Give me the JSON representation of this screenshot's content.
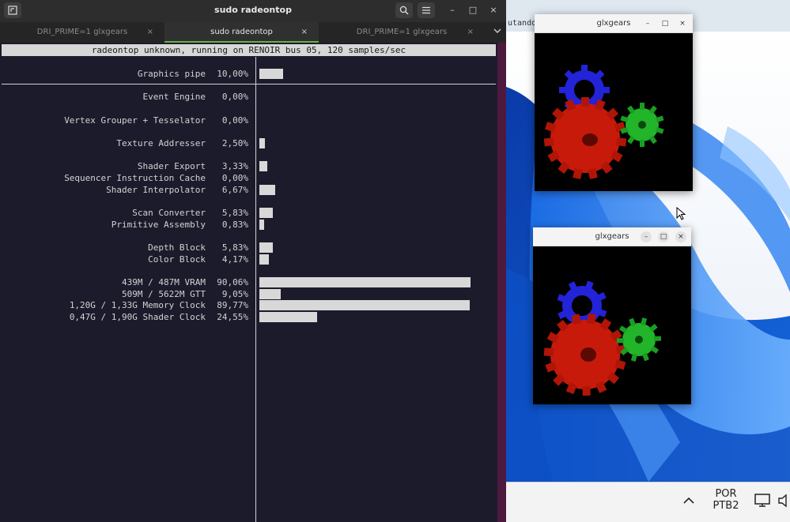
{
  "terminal": {
    "title": "sudo radeontop",
    "tabs": [
      {
        "label": "DRI_PRIME=1 glxgears"
      },
      {
        "label": "sudo radeontop"
      },
      {
        "label": "DRI_PRIME=1 glxgears"
      }
    ],
    "active_tab": 1,
    "header": "radeontop unknown, running on RENOIR bus 05, 120 samples/sec",
    "stats": [
      {
        "label": "Graphics pipe",
        "value": "10,00%",
        "fraction": 0.1
      },
      {
        "label": "Event Engine",
        "value": "0,00%",
        "fraction": 0.0
      },
      {
        "label": "Vertex Grouper + Tesselator",
        "value": "0,00%",
        "fraction": 0.0
      },
      {
        "label": "Texture Addresser",
        "value": "2,50%",
        "fraction": 0.025
      },
      {
        "label": "Shader Export",
        "value": "3,33%",
        "fraction": 0.0333
      },
      {
        "label": "Sequencer Instruction Cache",
        "value": "0,00%",
        "fraction": 0.0
      },
      {
        "label": "Shader Interpolator",
        "value": "6,67%",
        "fraction": 0.0667
      },
      {
        "label": "Scan Converter",
        "value": "5,83%",
        "fraction": 0.0583
      },
      {
        "label": "Primitive Assembly",
        "value": "0,83%",
        "fraction": 0.0083
      },
      {
        "label": "Depth Block",
        "value": "5,83%",
        "fraction": 0.0583
      },
      {
        "label": "Color Block",
        "value": "4,17%",
        "fraction": 0.0417
      },
      {
        "label": "439M / 487M VRAM",
        "value": "90,06%",
        "fraction": 0.9006
      },
      {
        "label": "509M / 5622M GTT",
        "value": "9,05%",
        "fraction": 0.0905
      },
      {
        "label": "1,20G / 1,33G Memory Clock",
        "value": "89,77%",
        "fraction": 0.8977
      },
      {
        "label": "0,47G / 1,90G Shader Clock",
        "value": "24,55%",
        "fraction": 0.2455
      }
    ],
    "colors": {
      "background": "#1c1b2c",
      "text": "#d2d2d2",
      "bar": "#d8d8d8",
      "active_tab_accent": "#65b043"
    }
  },
  "glxgears_windows": [
    {
      "title": "glxgears"
    },
    {
      "title": "glxgears"
    }
  ],
  "desktop": {
    "partial_text": "utando]",
    "taskbar": {
      "lang_line1": "POR",
      "lang_line2": "PTB2"
    }
  },
  "icons": {
    "new_tab": "new-tab-icon",
    "search": "search-icon",
    "menu": "hamburger-menu-icon",
    "minimize": "minimize-icon",
    "maximize": "maximize-icon",
    "close": "close-icon",
    "tabs_overflow": "chevron-down-icon",
    "tray_chevron": "chevron-up-icon",
    "display": "display-icon",
    "volume": "volume-icon"
  }
}
